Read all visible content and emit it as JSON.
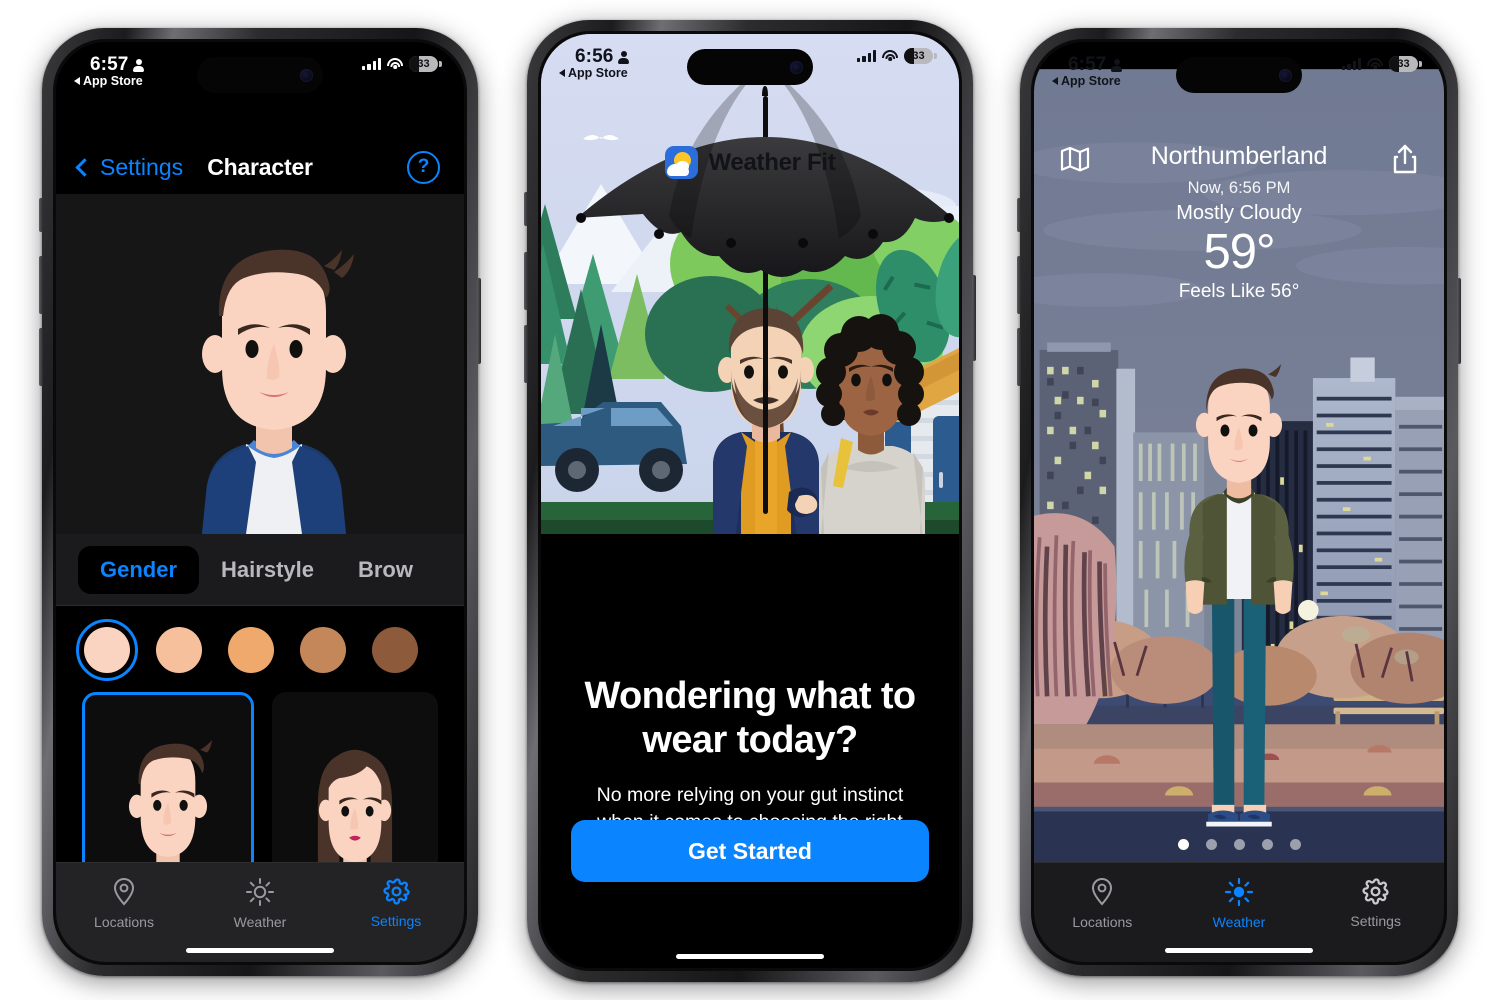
{
  "meta": {
    "scene": "Three iPhone screenshots of the Weather Fit app"
  },
  "phone1": {
    "name": "character-settings-screen",
    "status_bar": {
      "time": "6:57",
      "back_app": "App Store",
      "battery_percent": "33",
      "icons": [
        "person-icon",
        "cellular-signal-icon",
        "wifi-icon",
        "battery-icon"
      ]
    },
    "nav": {
      "back_label": "Settings",
      "title": "Character",
      "help_label": "?"
    },
    "segments": [
      {
        "label": "Gender",
        "active": true
      },
      {
        "label": "Hairstyle",
        "active": false
      },
      {
        "label": "Brow",
        "active": false
      }
    ],
    "skin_tones": [
      {
        "hex": "#fbd3c1",
        "selected": true
      },
      {
        "hex": "#f7c09c",
        "selected": false
      },
      {
        "hex": "#efa96c",
        "selected": false
      },
      {
        "hex": "#c4875a",
        "selected": false
      },
      {
        "hex": "#8d5b3c",
        "selected": false
      }
    ],
    "gender_cards": [
      {
        "name": "male-avatar-card",
        "selected": true
      },
      {
        "name": "female-avatar-card",
        "selected": false
      }
    ],
    "tabs": [
      {
        "label": "Locations",
        "icon": "location-pin-icon",
        "active": false
      },
      {
        "label": "Weather",
        "icon": "sun-icon",
        "active": false
      },
      {
        "label": "Settings",
        "icon": "gear-icon",
        "active": true
      }
    ],
    "accent": "#0a84ff"
  },
  "phone2": {
    "name": "onboarding-screen",
    "status_bar": {
      "time": "6:56",
      "back_app": "App Store",
      "battery_percent": "33"
    },
    "brand": {
      "name": "Weather Fit",
      "logo": "weather-fit-logo-icon"
    },
    "headline": "Wondering what to wear today?",
    "subtitle": "No more relying on your gut instinct when it comes to choosing the right clothing.",
    "cta_label": "Get Started",
    "cta_color": "#0a84ff"
  },
  "phone3": {
    "name": "weather-screen",
    "status_bar": {
      "time": "6:57",
      "back_app": "App Store",
      "battery_percent": "33"
    },
    "header": {
      "map_icon": "map-icon",
      "share_icon": "share-icon",
      "city": "Northumberland",
      "time_label": "Now, 6:56 PM",
      "condition": "Mostly Cloudy",
      "temperature": "59°",
      "feels_like": "Feels Like 56°"
    },
    "page_dots": {
      "count": 5,
      "active_index": 0
    },
    "tabs": [
      {
        "label": "Locations",
        "icon": "location-pin-icon",
        "active": false
      },
      {
        "label": "Weather",
        "icon": "sun-icon",
        "active": true
      },
      {
        "label": "Settings",
        "icon": "gear-icon",
        "active": false
      }
    ],
    "accent": "#0a84ff"
  }
}
